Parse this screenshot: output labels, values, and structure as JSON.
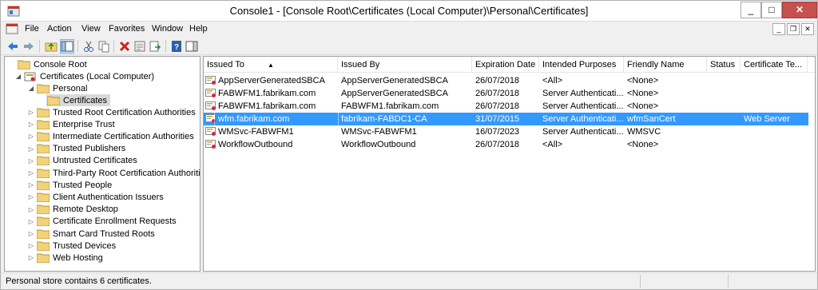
{
  "window": {
    "title": "Console1 - [Console Root\\Certificates (Local Computer)\\Personal\\Certificates]"
  },
  "menu": [
    "File",
    "Action",
    "View",
    "Favorites",
    "Window",
    "Help"
  ],
  "tree": {
    "root": "Console Root",
    "certificates": "Certificates (Local Computer)",
    "personal": "Personal",
    "certs_folder": "Certificates",
    "stores": [
      "Trusted Root Certification Authorities",
      "Enterprise Trust",
      "Intermediate Certification Authorities",
      "Trusted Publishers",
      "Untrusted Certificates",
      "Third-Party Root Certification Authorities",
      "Trusted People",
      "Client Authentication Issuers",
      "Remote Desktop",
      "Certificate Enrollment Requests",
      "Smart Card Trusted Roots",
      "Trusted Devices",
      "Web Hosting"
    ]
  },
  "columns": [
    "Issued To",
    "Issued By",
    "Expiration Date",
    "Intended Purposes",
    "Friendly Name",
    "Status",
    "Certificate Te..."
  ],
  "rows": [
    [
      "AppServerGeneratedSBCA",
      "AppServerGeneratedSBCA",
      "26/07/2018",
      "<All>",
      "<None>",
      "",
      ""
    ],
    [
      "FABWFM1.fabrikam.com",
      "AppServerGeneratedSBCA",
      "26/07/2018",
      "Server Authenticati...",
      "<None>",
      "",
      ""
    ],
    [
      "FABWFM1.fabrikam.com",
      "FABWFM1.fabrikam.com",
      "26/07/2018",
      "Server Authenticati...",
      "<None>",
      "",
      ""
    ],
    [
      "wfm.fabrikam.com",
      "fabrikam-FABDC1-CA",
      "31/07/2015",
      "Server Authenticati...",
      "wfmSanCert",
      "",
      "Web Server"
    ],
    [
      "WMSvc-FABWFM1",
      "WMSvc-FABWFM1",
      "16/07/2023",
      "Server Authenticati...",
      "WMSVC",
      "",
      ""
    ],
    [
      "WorkflowOutbound",
      "WorkflowOutbound",
      "26/07/2018",
      "<All>",
      "<None>",
      "",
      ""
    ]
  ],
  "selected_row": 3,
  "status": "Personal store contains 6 certificates.",
  "colors": {
    "selection": "#3399ff",
    "close": "#c75050",
    "folder": "#f2d27a"
  }
}
